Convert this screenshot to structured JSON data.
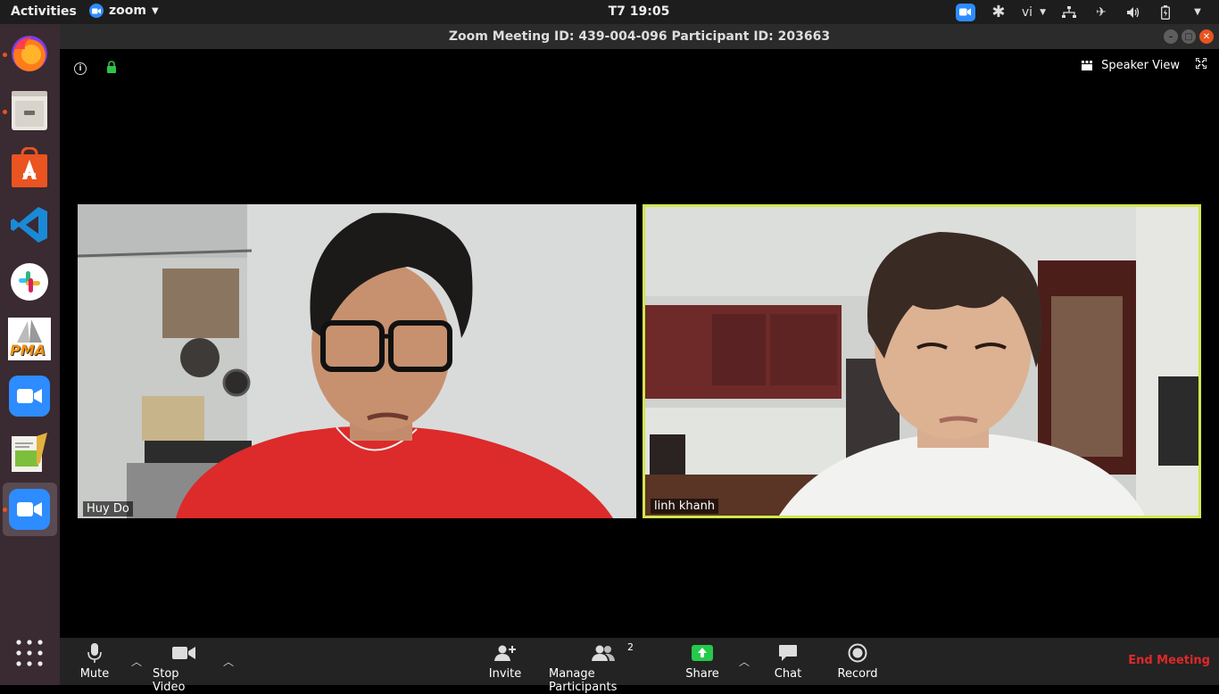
{
  "topbar": {
    "activities": "Activities",
    "app_name": "zoom",
    "clock": "T7 19:05",
    "input_lang": "vi"
  },
  "window": {
    "title": "Zoom Meeting ID: 439-004-096 Participant ID: 203663"
  },
  "dock": {
    "items": [
      "firefox",
      "files",
      "ubuntu-software",
      "vscode",
      "slack",
      "phpmyadmin",
      "zoom",
      "text-editor",
      "zoom-active"
    ],
    "pma_label": "PMA"
  },
  "meeting": {
    "view_label": "Speaker View",
    "participants": [
      {
        "name": "Huy Do"
      },
      {
        "name": "linh khanh"
      }
    ]
  },
  "toolbar": {
    "mute": "Mute",
    "stop_video": "Stop Video",
    "invite": "Invite",
    "manage_participants": "Manage Participants",
    "participant_count": "2",
    "share": "Share",
    "chat": "Chat",
    "record": "Record",
    "end_meeting": "End Meeting"
  },
  "colors": {
    "accent_blue": "#2d8cff",
    "active_speaker": "#d2e64f",
    "share_green": "#26c94c",
    "end_red": "#e02828"
  }
}
